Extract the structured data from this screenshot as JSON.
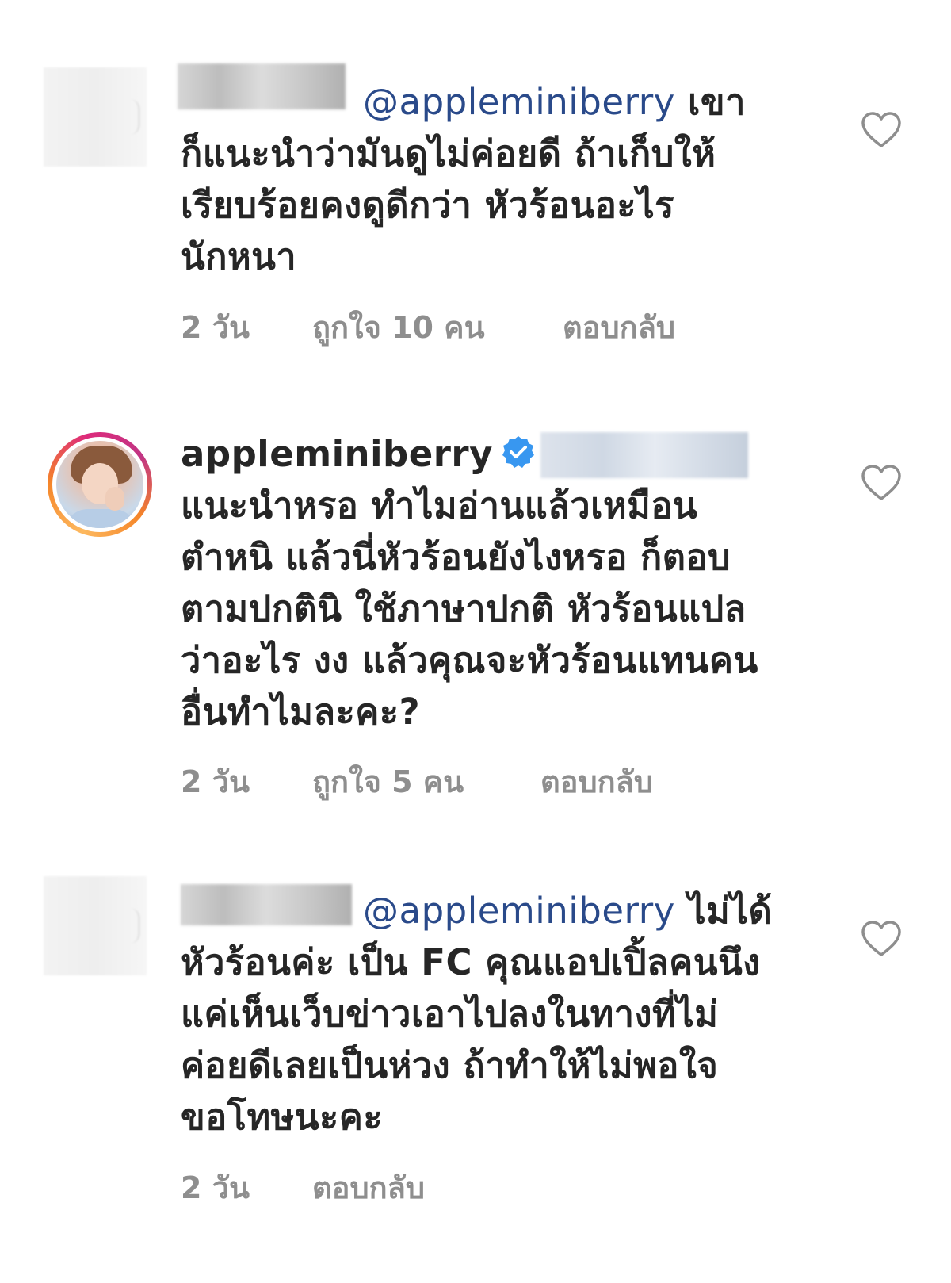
{
  "comments": [
    {
      "username": "",
      "mention": "@appleminiberry",
      "lines": [
        "เขา",
        "ก็แนะนำว่ามันดูไม่ค่อยดี ถ้าเก็บให้",
        "เรียบร้อยคงดูดีกว่า หัวร้อนอะไร",
        "นักหนา"
      ],
      "time": "2 วัน",
      "likes": "ถูกใจ 10 คน",
      "reply": "ตอบกลับ",
      "heart_icon": "heart-outline-icon"
    },
    {
      "username": "appleminiberry",
      "verified_icon": "verified-badge-icon",
      "lines": [
        "แนะนำหรอ ทำไมอ่านแล้วเหมือน",
        "ตำหนิ แล้วนี่หัวร้อนยังไงหรอ ก็ตอบ",
        "ตามปกตินิ ใช้ภาษาปกติ หัวร้อนแปล",
        "ว่าอะไร งง แล้วคุณจะหัวร้อนแทนคน",
        "อื่นทำไมละคะ?"
      ],
      "time": "2 วัน",
      "likes": "ถูกใจ 5 คน",
      "reply": "ตอบกลับ",
      "heart_icon": "heart-outline-icon"
    },
    {
      "username": "",
      "mention": "@appleminiberry",
      "lines": [
        "ไม่ได้",
        "หัวร้อนค่ะ เป็น FC คุณแอปเปิ้ลคนนึง",
        "แค่เห็นเว็บข่าวเอาไปลงในทางที่ไม่",
        "ค่อยดีเลยเป็นห่วง ถ้าทำให้ไม่พอใจ",
        "ขอโทษนะคะ"
      ],
      "time": "2 วัน",
      "reply": "ตอบกลับ",
      "heart_icon": "heart-outline-icon"
    }
  ],
  "colors": {
    "mention": "#2a4a8a",
    "meta": "#8e8e8e",
    "text": "#262626",
    "verified": "#3897f0"
  }
}
